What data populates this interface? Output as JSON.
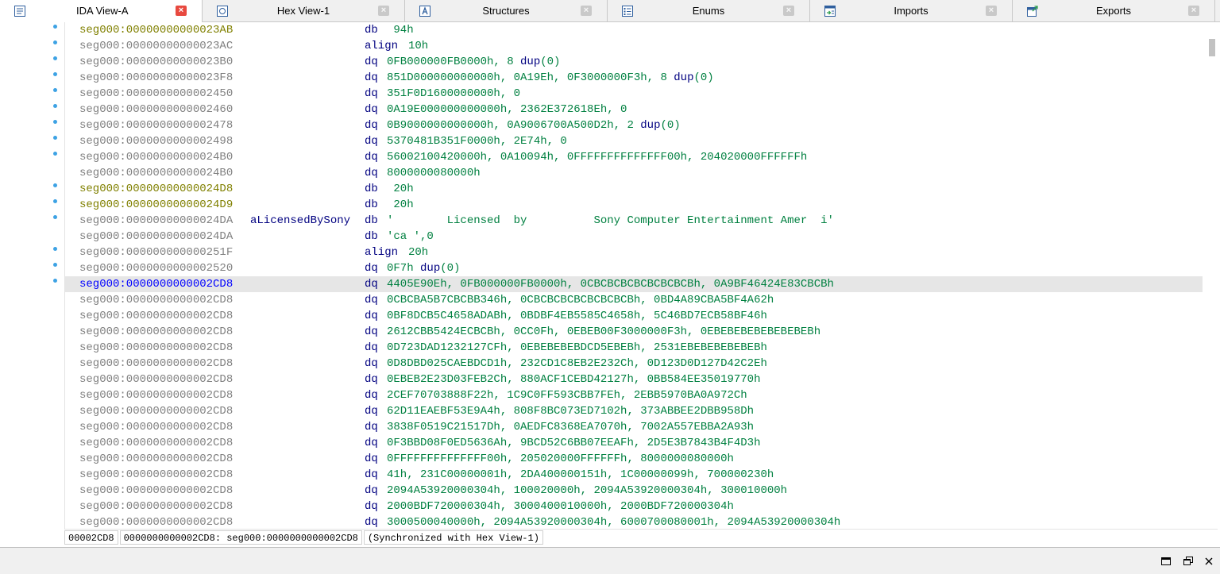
{
  "tabs": [
    {
      "label": "IDA View-A",
      "icon": "ida-view-icon",
      "active": true
    },
    {
      "label": "Hex View-1",
      "icon": "hex-view-icon",
      "active": false
    },
    {
      "label": "Structures",
      "icon": "structures-icon",
      "active": false
    },
    {
      "label": "Enums",
      "icon": "enums-icon",
      "active": false
    },
    {
      "label": "Imports",
      "icon": "imports-icon",
      "active": false
    },
    {
      "label": "Exports",
      "icon": "exports-icon",
      "active": false
    }
  ],
  "tab_close_glyph": "×",
  "listing": {
    "rows": [
      {
        "addr": "seg000:00000000000023AB",
        "label": "",
        "mnem": "db",
        "ops": " 94h",
        "kind": "data",
        "dot": true
      },
      {
        "addr": "seg000:00000000000023AC",
        "label": "",
        "mnem": "align",
        "ops": "10h",
        "kind": "normal",
        "dot": true
      },
      {
        "addr": "seg000:00000000000023B0",
        "label": "",
        "mnem": "dq",
        "ops": "0FB000000FB0000h, 8 dup(0)",
        "kind": "normal",
        "dot": true
      },
      {
        "addr": "seg000:00000000000023F8",
        "label": "",
        "mnem": "dq",
        "ops": "851D000000000000h, 0A19Eh, 0F3000000F3h, 8 dup(0)",
        "kind": "normal",
        "dot": true
      },
      {
        "addr": "seg000:0000000000002450",
        "label": "",
        "mnem": "dq",
        "ops": "351F0D1600000000h, 0",
        "kind": "normal",
        "dot": true
      },
      {
        "addr": "seg000:0000000000002460",
        "label": "",
        "mnem": "dq",
        "ops": "0A19E000000000000h, 2362E372618Eh, 0",
        "kind": "normal",
        "dot": true
      },
      {
        "addr": "seg000:0000000000002478",
        "label": "",
        "mnem": "dq",
        "ops": "0B9000000000000h, 0A9006700A500D2h, 2 dup(0)",
        "kind": "normal",
        "dot": true
      },
      {
        "addr": "seg000:0000000000002498",
        "label": "",
        "mnem": "dq",
        "ops": "5370481B351F0000h, 2E74h, 0",
        "kind": "normal",
        "dot": true
      },
      {
        "addr": "seg000:00000000000024B0",
        "label": "",
        "mnem": "dq",
        "ops": "56002100420000h, 0A10094h, 0FFFFFFFFFFFFFF00h, 204020000FFFFFFh",
        "kind": "normal",
        "dot": true
      },
      {
        "addr": "seg000:00000000000024B0",
        "label": "",
        "mnem": "dq",
        "ops": "8000000080000h",
        "kind": "normal",
        "dot": false
      },
      {
        "addr": "seg000:00000000000024D8",
        "label": "",
        "mnem": "db",
        "ops": " 20h",
        "kind": "data",
        "dot": true
      },
      {
        "addr": "seg000:00000000000024D9",
        "label": "",
        "mnem": "db",
        "ops": " 20h",
        "kind": "data",
        "dot": true
      },
      {
        "addr": "seg000:00000000000024DA",
        "label": "aLicensedBySony",
        "mnem": "db",
        "ops": "'        Licensed  by          Sony Computer Entertainment Amer  i'",
        "kind": "normal",
        "dot": true
      },
      {
        "addr": "seg000:00000000000024DA",
        "label": "",
        "mnem": "db",
        "ops": "'ca ',0",
        "kind": "normal",
        "dot": false
      },
      {
        "addr": "seg000:000000000000251F",
        "label": "",
        "mnem": "align",
        "ops": "20h",
        "kind": "normal",
        "dot": true
      },
      {
        "addr": "seg000:0000000000002520",
        "label": "",
        "mnem": "dq",
        "ops": "0F7h dup(0)",
        "kind": "normal",
        "dot": true
      },
      {
        "addr": "seg000:0000000000002CD8",
        "label": "",
        "mnem": "dq",
        "ops": "4405E90Eh, 0FB000000FB0000h, 0CBCBCBCBCBCBCBCBh, 0A9BF46424E83CBCBh",
        "kind": "cur",
        "dot": true
      },
      {
        "addr": "seg000:0000000000002CD8",
        "label": "",
        "mnem": "dq",
        "ops": "0CBCBA5B7CBCBB346h, 0CBCBCBCBCBCBCBCBh, 0BD4A89CBA5BF4A62h",
        "kind": "normal",
        "dot": false
      },
      {
        "addr": "seg000:0000000000002CD8",
        "label": "",
        "mnem": "dq",
        "ops": "0BF8DCB5C4658ADABh, 0BDBF4EB5585C4658h, 5C46BD7ECB58BF46h",
        "kind": "normal",
        "dot": false
      },
      {
        "addr": "seg000:0000000000002CD8",
        "label": "",
        "mnem": "dq",
        "ops": "2612CBB5424ECBCBh, 0CC0Fh, 0EBEB00F3000000F3h, 0EBEBEBEBEBEBEBEBh",
        "kind": "normal",
        "dot": false
      },
      {
        "addr": "seg000:0000000000002CD8",
        "label": "",
        "mnem": "dq",
        "ops": "0D723DAD1232127CFh, 0EBEBEBEBDCD5EBEBh, 2531EBEBEBEBEBEBh",
        "kind": "normal",
        "dot": false
      },
      {
        "addr": "seg000:0000000000002CD8",
        "label": "",
        "mnem": "dq",
        "ops": "0D8DBD025CAEBDCD1h, 232CD1C8EB2E232Ch, 0D123D0D127D42C2Eh",
        "kind": "normal",
        "dot": false
      },
      {
        "addr": "seg000:0000000000002CD8",
        "label": "",
        "mnem": "dq",
        "ops": "0EBEB2E23D03FEB2Ch, 880ACF1CEBD42127h, 0BB584EE35019770h",
        "kind": "normal",
        "dot": false
      },
      {
        "addr": "seg000:0000000000002CD8",
        "label": "",
        "mnem": "dq",
        "ops": "2CEF70703888F22h, 1C9C0FF593CBB7FEh, 2EBB5970BA0A972Ch",
        "kind": "normal",
        "dot": false
      },
      {
        "addr": "seg000:0000000000002CD8",
        "label": "",
        "mnem": "dq",
        "ops": "62D11EAEBF53E9A4h, 808F8BC073ED7102h, 373ABBEE2DBB958Dh",
        "kind": "normal",
        "dot": false
      },
      {
        "addr": "seg000:0000000000002CD8",
        "label": "",
        "mnem": "dq",
        "ops": "3838F0519C21517Dh, 0AEDFC8368EA7070h, 7002A557EBBA2A93h",
        "kind": "normal",
        "dot": false
      },
      {
        "addr": "seg000:0000000000002CD8",
        "label": "",
        "mnem": "dq",
        "ops": "0F3BBD08F0ED5636Ah, 9BCD52C6BB07EEAFh, 2D5E3B7843B4F4D3h",
        "kind": "normal",
        "dot": false
      },
      {
        "addr": "seg000:0000000000002CD8",
        "label": "",
        "mnem": "dq",
        "ops": "0FFFFFFFFFFFFFF00h, 205020000FFFFFFh, 8000000080000h",
        "kind": "normal",
        "dot": false
      },
      {
        "addr": "seg000:0000000000002CD8",
        "label": "",
        "mnem": "dq",
        "ops": "41h, 231C00000001h, 2DA400000151h, 1C00000099h, 700000230h",
        "kind": "normal",
        "dot": false
      },
      {
        "addr": "seg000:0000000000002CD8",
        "label": "",
        "mnem": "dq",
        "ops": "2094A53920000304h, 100020000h, 2094A53920000304h, 300010000h",
        "kind": "normal",
        "dot": false
      },
      {
        "addr": "seg000:0000000000002CD8",
        "label": "",
        "mnem": "dq",
        "ops": "2000BDF720000304h, 3000400010000h, 2000BDF720000304h",
        "kind": "normal",
        "dot": false
      },
      {
        "addr": "seg000:0000000000002CD8",
        "label": "",
        "mnem": "dq",
        "ops": "3000500040000h, 2094A53920000304h, 6000700080001h, 2094A53920000304h",
        "kind": "normal",
        "dot": false
      }
    ]
  },
  "status": {
    "offset": "00002CD8",
    "location": "0000000000002CD8: seg000:0000000000002CD8",
    "sync": "(Synchronized with Hex View-1)"
  },
  "colors": {
    "address": "#808080",
    "address_data": "#808000",
    "address_current": "#0000ff",
    "mnemonic": "#000080",
    "operand": "#008040",
    "selected_row": "#e6e6e6",
    "breakpoint_dot": "#3da2e4",
    "active_tab_close": "#e8493f"
  }
}
